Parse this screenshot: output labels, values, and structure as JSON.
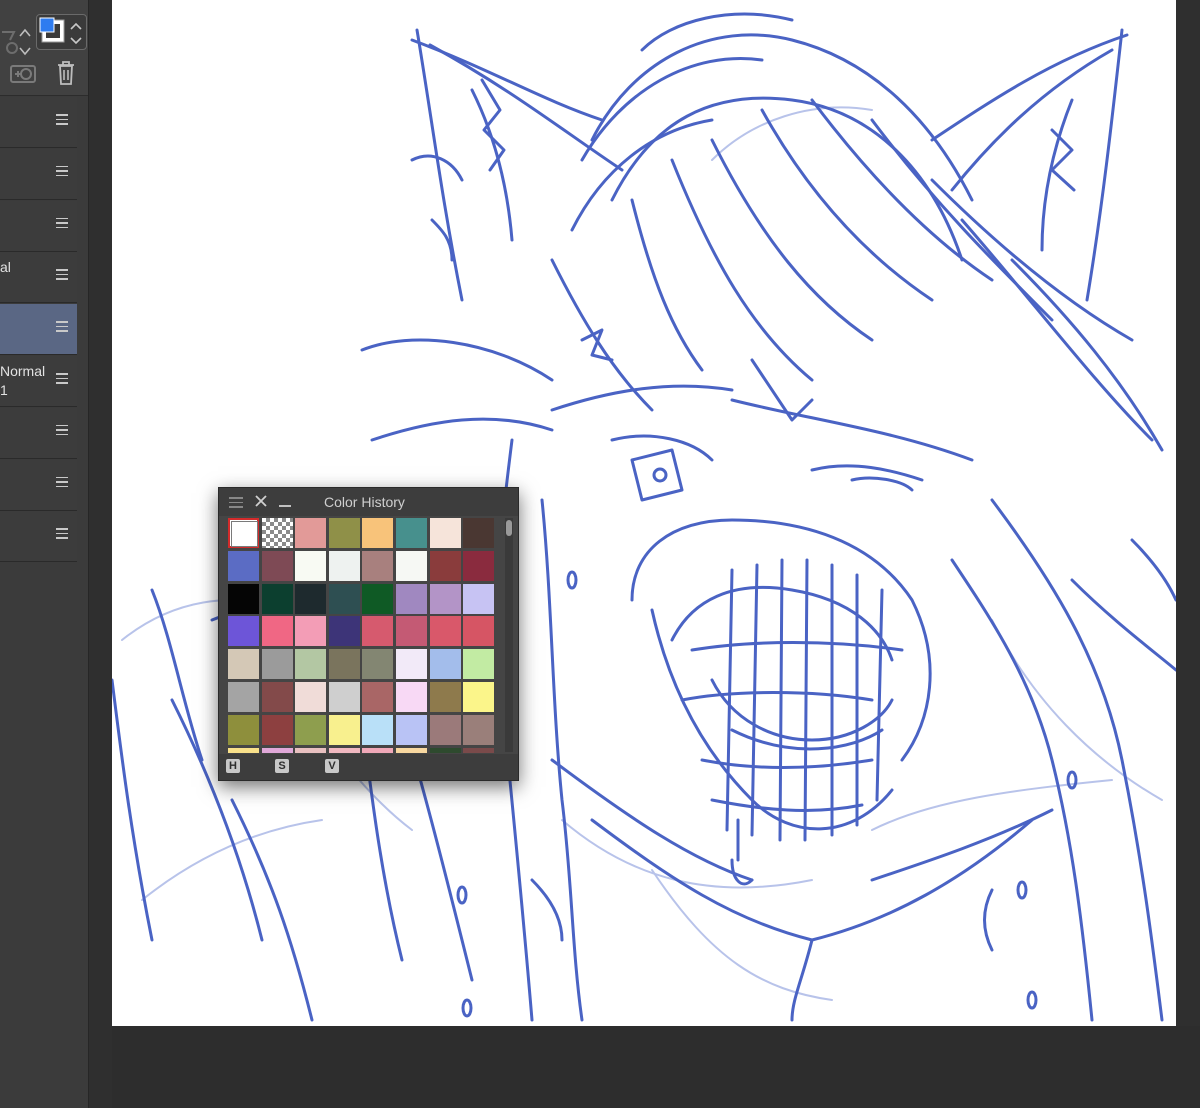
{
  "panel": {
    "layers": [
      {
        "line1": "",
        "line2": "",
        "selected": false
      },
      {
        "line1": "",
        "line2": "",
        "selected": false
      },
      {
        "line1": "",
        "line2": "",
        "selected": false
      },
      {
        "line1": "al",
        "line2": "",
        "selected": false
      },
      {
        "line1": "",
        "line2": "",
        "selected": true
      },
      {
        "line1": "Normal",
        "line2": "1",
        "selected": false
      },
      {
        "line1": "",
        "line2": "",
        "selected": false
      },
      {
        "line1": "",
        "line2": "",
        "selected": false
      },
      {
        "line1": "",
        "line2": "",
        "selected": false
      }
    ]
  },
  "palette": {
    "title": "Color History",
    "modes": [
      "H",
      "S",
      "V"
    ],
    "swatches": [
      [
        "#ffffff",
        "transparent",
        "#e29a98",
        "#8f9048",
        "#f8c37a",
        "#47908d",
        "#f6e4da",
        "#4a3732"
      ],
      [
        "#5b6cc4",
        "#7e4a55",
        "#f8faf3",
        "#eef2f0",
        "#a8807e",
        "#f6f8f4",
        "#8a3c3c",
        "#8a2b3e"
      ],
      [
        "#050505",
        "#0c3f2f",
        "#1e2a2e",
        "#2e4f52",
        "#0f5a25",
        "#a088c0",
        "#b394c7",
        "#c7c3f3"
      ],
      [
        "#6d55d8",
        "#f06784",
        "#f39db6",
        "#3d3478",
        "#d65a6e",
        "#c45a74",
        "#d9586a",
        "#d65564"
      ],
      [
        "#d4c8b6",
        "#9b9b9b",
        "#b3c7a3",
        "#7a745d",
        "#838672",
        "#f2eaf8",
        "#a3bdeb",
        "#c2eba3"
      ],
      [
        "#a4a4a4",
        "#834a4a",
        "#f0dcd8",
        "#cfcfcf",
        "#a96666",
        "#f8d9f5",
        "#8e7a4c",
        "#fbf58a"
      ],
      [
        "#8e8f3c",
        "#8d4040",
        "#8e9e4e",
        "#f8f08e",
        "#b9e0f8",
        "#b9c3f5",
        "#9b7a7a",
        "#9a7f7a"
      ],
      [
        "#f8e08a",
        "#e0a8d8",
        "#e8c0c0",
        "#f0b8c0",
        "#f0a8b8",
        "#f8d8a0",
        "#2e4a2e",
        "#7a4a4a"
      ]
    ]
  },
  "colors": {
    "stroke": "#4a63c4",
    "stroke_light": "#b8c3ea",
    "accent_selected": "#5a6784"
  },
  "icons": {
    "toolbar": [
      "color-swap-icon",
      "new-layer-icon",
      "trash-icon"
    ]
  }
}
